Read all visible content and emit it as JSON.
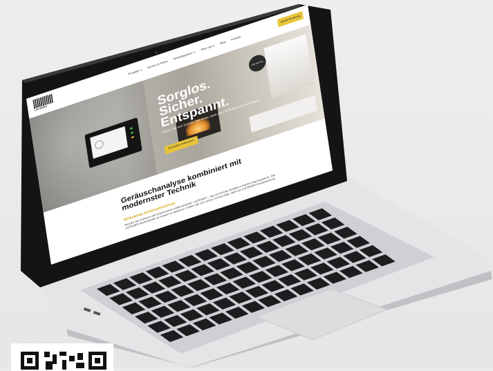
{
  "screen": {
    "logo_text": "LISTENER",
    "nav": [
      "Produkte ∨",
      "Service & Preise",
      "Vertriebspartner ∨",
      "Über uns ∨",
      "Blog",
      "Kontakt"
    ],
    "cta": "Gratis Beratung",
    "hero": {
      "headline_lines": [
        "Sorglos.",
        "Sicher.",
        "Entspannt."
      ],
      "subtitle": "Fühlen Sie sich zu jeder Zeit sicher, dank der LISTENER-Schutzsysteme.",
      "button": "Produkte entdecken",
      "badge": "DIN EN ISO"
    },
    "section": {
      "heading": "Geräuschanalyse kombiniert mit modernster Technik",
      "subheading": "Wirksamer Einbruchsschutz",
      "paragraph": "Machen Sie Zuhause und Unternehmen einbruchsicher. LISTENER – das ist höchste Qualität in Sachen Alarmsysteme. Die LISTENER-Gerätefamilie ist einfach zu bedienen. Fühlen Sie sich sicher und beruhigt, dank der LISTENER-Schutzsysteme."
    }
  },
  "colors": {
    "accent": "#e8c53a",
    "laptop_body": "#e7e8ea",
    "keyboard": "#1d1d1f"
  }
}
